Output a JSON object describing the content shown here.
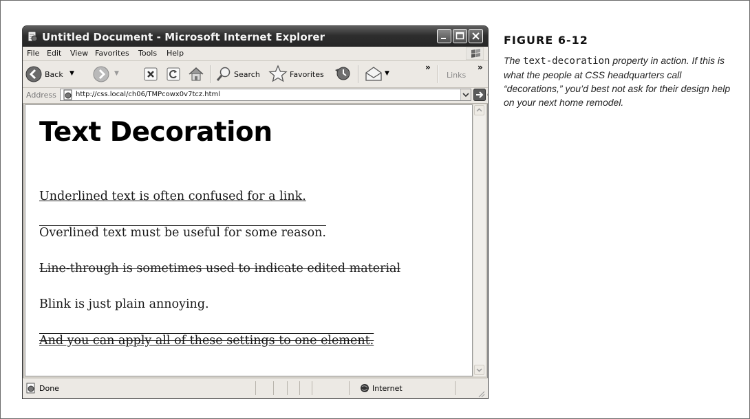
{
  "window": {
    "title": "Untitled Document - Microsoft Internet Explorer"
  },
  "menu": [
    "File",
    "Edit",
    "View",
    "Favorites",
    "Tools",
    "Help"
  ],
  "toolbar": {
    "back_label": "Back",
    "search_label": "Search",
    "favorites_label": "Favorites",
    "chevron": "»",
    "links_label": "Links"
  },
  "address": {
    "label": "Address",
    "url": "http://css.local/ch06/TMPcowx0v7tcz.html",
    "go_label": "Go"
  },
  "page": {
    "heading": "Text Decoration",
    "lines": [
      "Underlined text is often confused for a link.",
      "Overlined text must be useful for some reason.",
      "Line-through is sometimes used to indicate edited material",
      "Blink is just plain annoying.",
      "And you can apply all of these settings to one element."
    ]
  },
  "status": {
    "text": "Done",
    "zone": "Internet"
  },
  "figure": {
    "number": "FIGURE 6-12",
    "caption_pre": "The ",
    "caption_code": "text-decoration",
    "caption_post": " property in action. If this is what the people at CSS headquarters call “decorations,” you’d best not ask for their design help on your next home remodel."
  }
}
